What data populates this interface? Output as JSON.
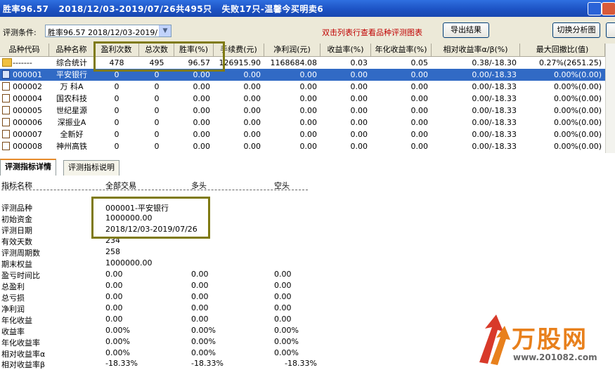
{
  "window": {
    "title": "胜率96.57   2018/12/03-2019/07/26共495只   失败17只-温馨今买明卖6"
  },
  "toolbar": {
    "condition_label": "评测条件:",
    "condition_value": "胜率96.57   2018/12/03-2019/",
    "hint": "双击列表行查看品种评测图表",
    "export_label": "导出结果",
    "switch_label": "切换分析图"
  },
  "grid": {
    "headers": [
      "品种代码",
      "品种名称",
      "盈利次数",
      "总次数",
      "胜率(%)",
      "手续费(元)",
      "净利润(元)",
      "收益率(%)",
      "年化收益率(%)",
      "相对收益率α/β(%)",
      "最大回撤比(值)"
    ],
    "rows": [
      {
        "code": "-------",
        "name": "综合统计",
        "wins": "478",
        "total": "495",
        "rate": "96.57",
        "fee": "126915.90",
        "profit": "1168684.08",
        "ret": "0.03",
        "annual": "0.05",
        "alpha": "0.38/-18.30",
        "dd": "0.27%(2651.25)",
        "icon": "folder-icon"
      },
      {
        "code": "000001",
        "name": "平安银行",
        "wins": "0",
        "total": "0",
        "rate": "0.00",
        "fee": "0.00",
        "profit": "0.00",
        "ret": "0.00",
        "annual": "0.00",
        "alpha": "0.00/-18.33",
        "dd": "0.00%(0.00)",
        "icon": "document-icon"
      },
      {
        "code": "000002",
        "name": "万 科A",
        "wins": "0",
        "total": "0",
        "rate": "0.00",
        "fee": "0.00",
        "profit": "0.00",
        "ret": "0.00",
        "annual": "0.00",
        "alpha": "0.00/-18.33",
        "dd": "0.00%(0.00)",
        "icon": "document-icon"
      },
      {
        "code": "000004",
        "name": "国农科技",
        "wins": "0",
        "total": "0",
        "rate": "0.00",
        "fee": "0.00",
        "profit": "0.00",
        "ret": "0.00",
        "annual": "0.00",
        "alpha": "0.00/-18.33",
        "dd": "0.00%(0.00)",
        "icon": "document-icon"
      },
      {
        "code": "000005",
        "name": "世纪星源",
        "wins": "0",
        "total": "0",
        "rate": "0.00",
        "fee": "0.00",
        "profit": "0.00",
        "ret": "0.00",
        "annual": "0.00",
        "alpha": "0.00/-18.33",
        "dd": "0.00%(0.00)",
        "icon": "document-icon"
      },
      {
        "code": "000006",
        "name": "深振业A",
        "wins": "0",
        "total": "0",
        "rate": "0.00",
        "fee": "0.00",
        "profit": "0.00",
        "ret": "0.00",
        "annual": "0.00",
        "alpha": "0.00/-18.33",
        "dd": "0.00%(0.00)",
        "icon": "document-icon"
      },
      {
        "code": "000007",
        "name": "全新好",
        "wins": "0",
        "total": "0",
        "rate": "0.00",
        "fee": "0.00",
        "profit": "0.00",
        "ret": "0.00",
        "annual": "0.00",
        "alpha": "0.00/-18.33",
        "dd": "0.00%(0.00)",
        "icon": "document-icon"
      },
      {
        "code": "000008",
        "name": "神州高铁",
        "wins": "0",
        "total": "0",
        "rate": "0.00",
        "fee": "0.00",
        "profit": "0.00",
        "ret": "0.00",
        "annual": "0.00",
        "alpha": "0.00/-18.33",
        "dd": "0.00%(0.00)",
        "icon": "document-icon"
      }
    ]
  },
  "tabs": [
    "评测指标详情",
    "评测指标说明"
  ],
  "detail": {
    "headers": [
      "指标名称",
      "全部交易",
      "多头",
      "空头"
    ],
    "rows": [
      [
        "评测品种",
        "000001-平安银行",
        "",
        ""
      ],
      [
        "初始资金",
        "1000000.00",
        "",
        ""
      ],
      [
        "评测日期",
        "2018/12/03-2019/07/26",
        "",
        ""
      ],
      [
        "有效天数",
        "234",
        "",
        ""
      ],
      [
        "评测周期数",
        "258",
        "",
        ""
      ],
      [
        "期末权益",
        "1000000.00",
        "",
        ""
      ],
      [
        "盈亏时间比",
        "0.00",
        "0.00",
        "0.00"
      ],
      [
        "总盈利",
        "0.00",
        "0.00",
        "0.00"
      ],
      [
        "总亏损",
        "0.00",
        "0.00",
        "0.00"
      ],
      [
        "净利润",
        "0.00",
        "0.00",
        "0.00"
      ],
      [
        "年化收益",
        "0.00",
        "0.00",
        "0.00"
      ],
      [
        "收益率",
        "0.00%",
        "0.00%",
        "0.00%"
      ],
      [
        "年化收益率",
        "0.00%",
        "0.00%",
        "0.00%"
      ],
      [
        "相对收益率α",
        "0.00%",
        "0.00%",
        "0.00%"
      ],
      [
        "相对收益率β",
        "-18.33%",
        "-18.33%",
        "-18.33%"
      ]
    ]
  },
  "watermark": {
    "brand": "万股网",
    "url": "www.201082.com"
  },
  "colors": {
    "title_bar": "#1d53c4",
    "selection": "#316ac5",
    "highlight_box": "#7f7a12",
    "hint_text": "#c00000",
    "brand": "#e8801c"
  }
}
